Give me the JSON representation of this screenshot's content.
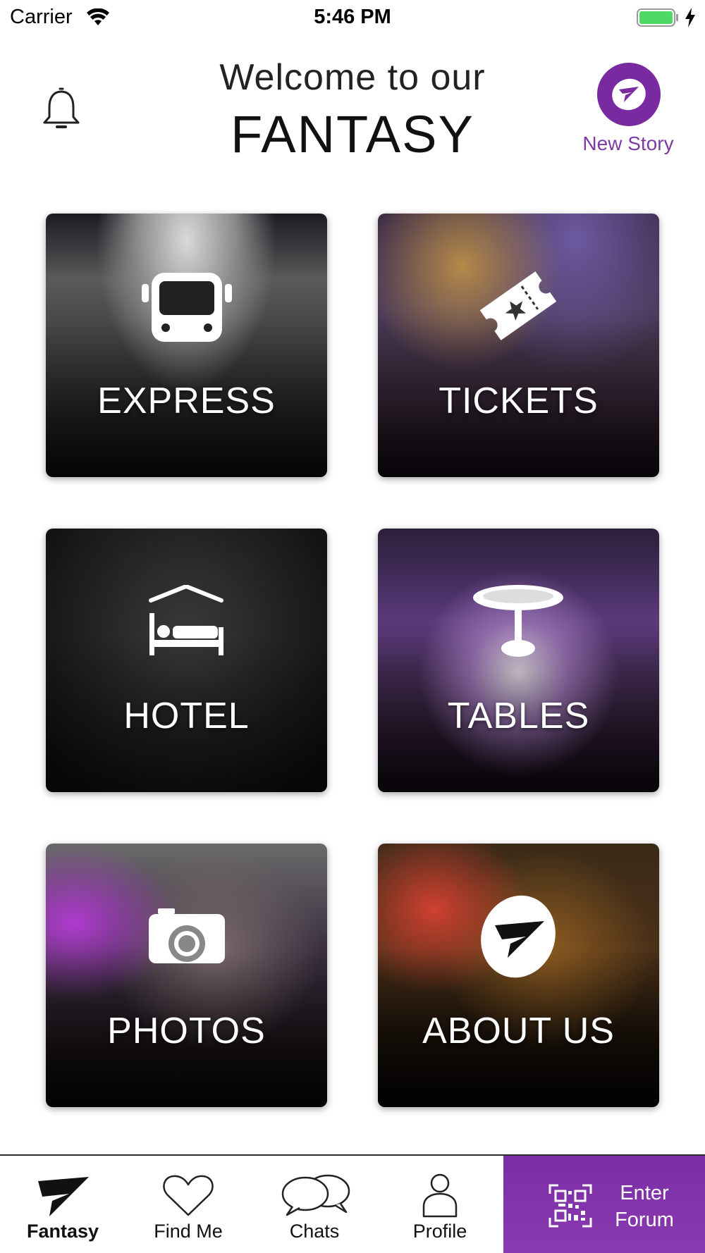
{
  "status_bar": {
    "carrier": "Carrier",
    "time": "5:46 PM"
  },
  "header": {
    "welcome_line": "Welcome to our",
    "title": "FANTASY",
    "new_story_label": "New Story"
  },
  "tiles": [
    {
      "label": "EXPRESS",
      "icon": "bus-icon"
    },
    {
      "label": "TICKETS",
      "icon": "ticket-icon"
    },
    {
      "label": "HOTEL",
      "icon": "bed-icon"
    },
    {
      "label": "TABLES",
      "icon": "table-icon"
    },
    {
      "label": "PHOTOS",
      "icon": "camera-icon"
    },
    {
      "label": "ABOUT US",
      "icon": "fantasy-logo-icon"
    }
  ],
  "bottom_nav": {
    "items": [
      {
        "label": "Fantasy",
        "icon": "fantasy-logo-icon",
        "active": true
      },
      {
        "label": "Find Me",
        "icon": "heart-icon"
      },
      {
        "label": "Chats",
        "icon": "chat-bubbles-icon"
      },
      {
        "label": "Profile",
        "icon": "person-icon"
      }
    ],
    "enter_forum_line1": "Enter",
    "enter_forum_line2": "Forum"
  },
  "colors": {
    "brand_purple": "#7a2aa0",
    "new_story_text": "#7d3aa3",
    "battery_green": "#4cd964"
  }
}
